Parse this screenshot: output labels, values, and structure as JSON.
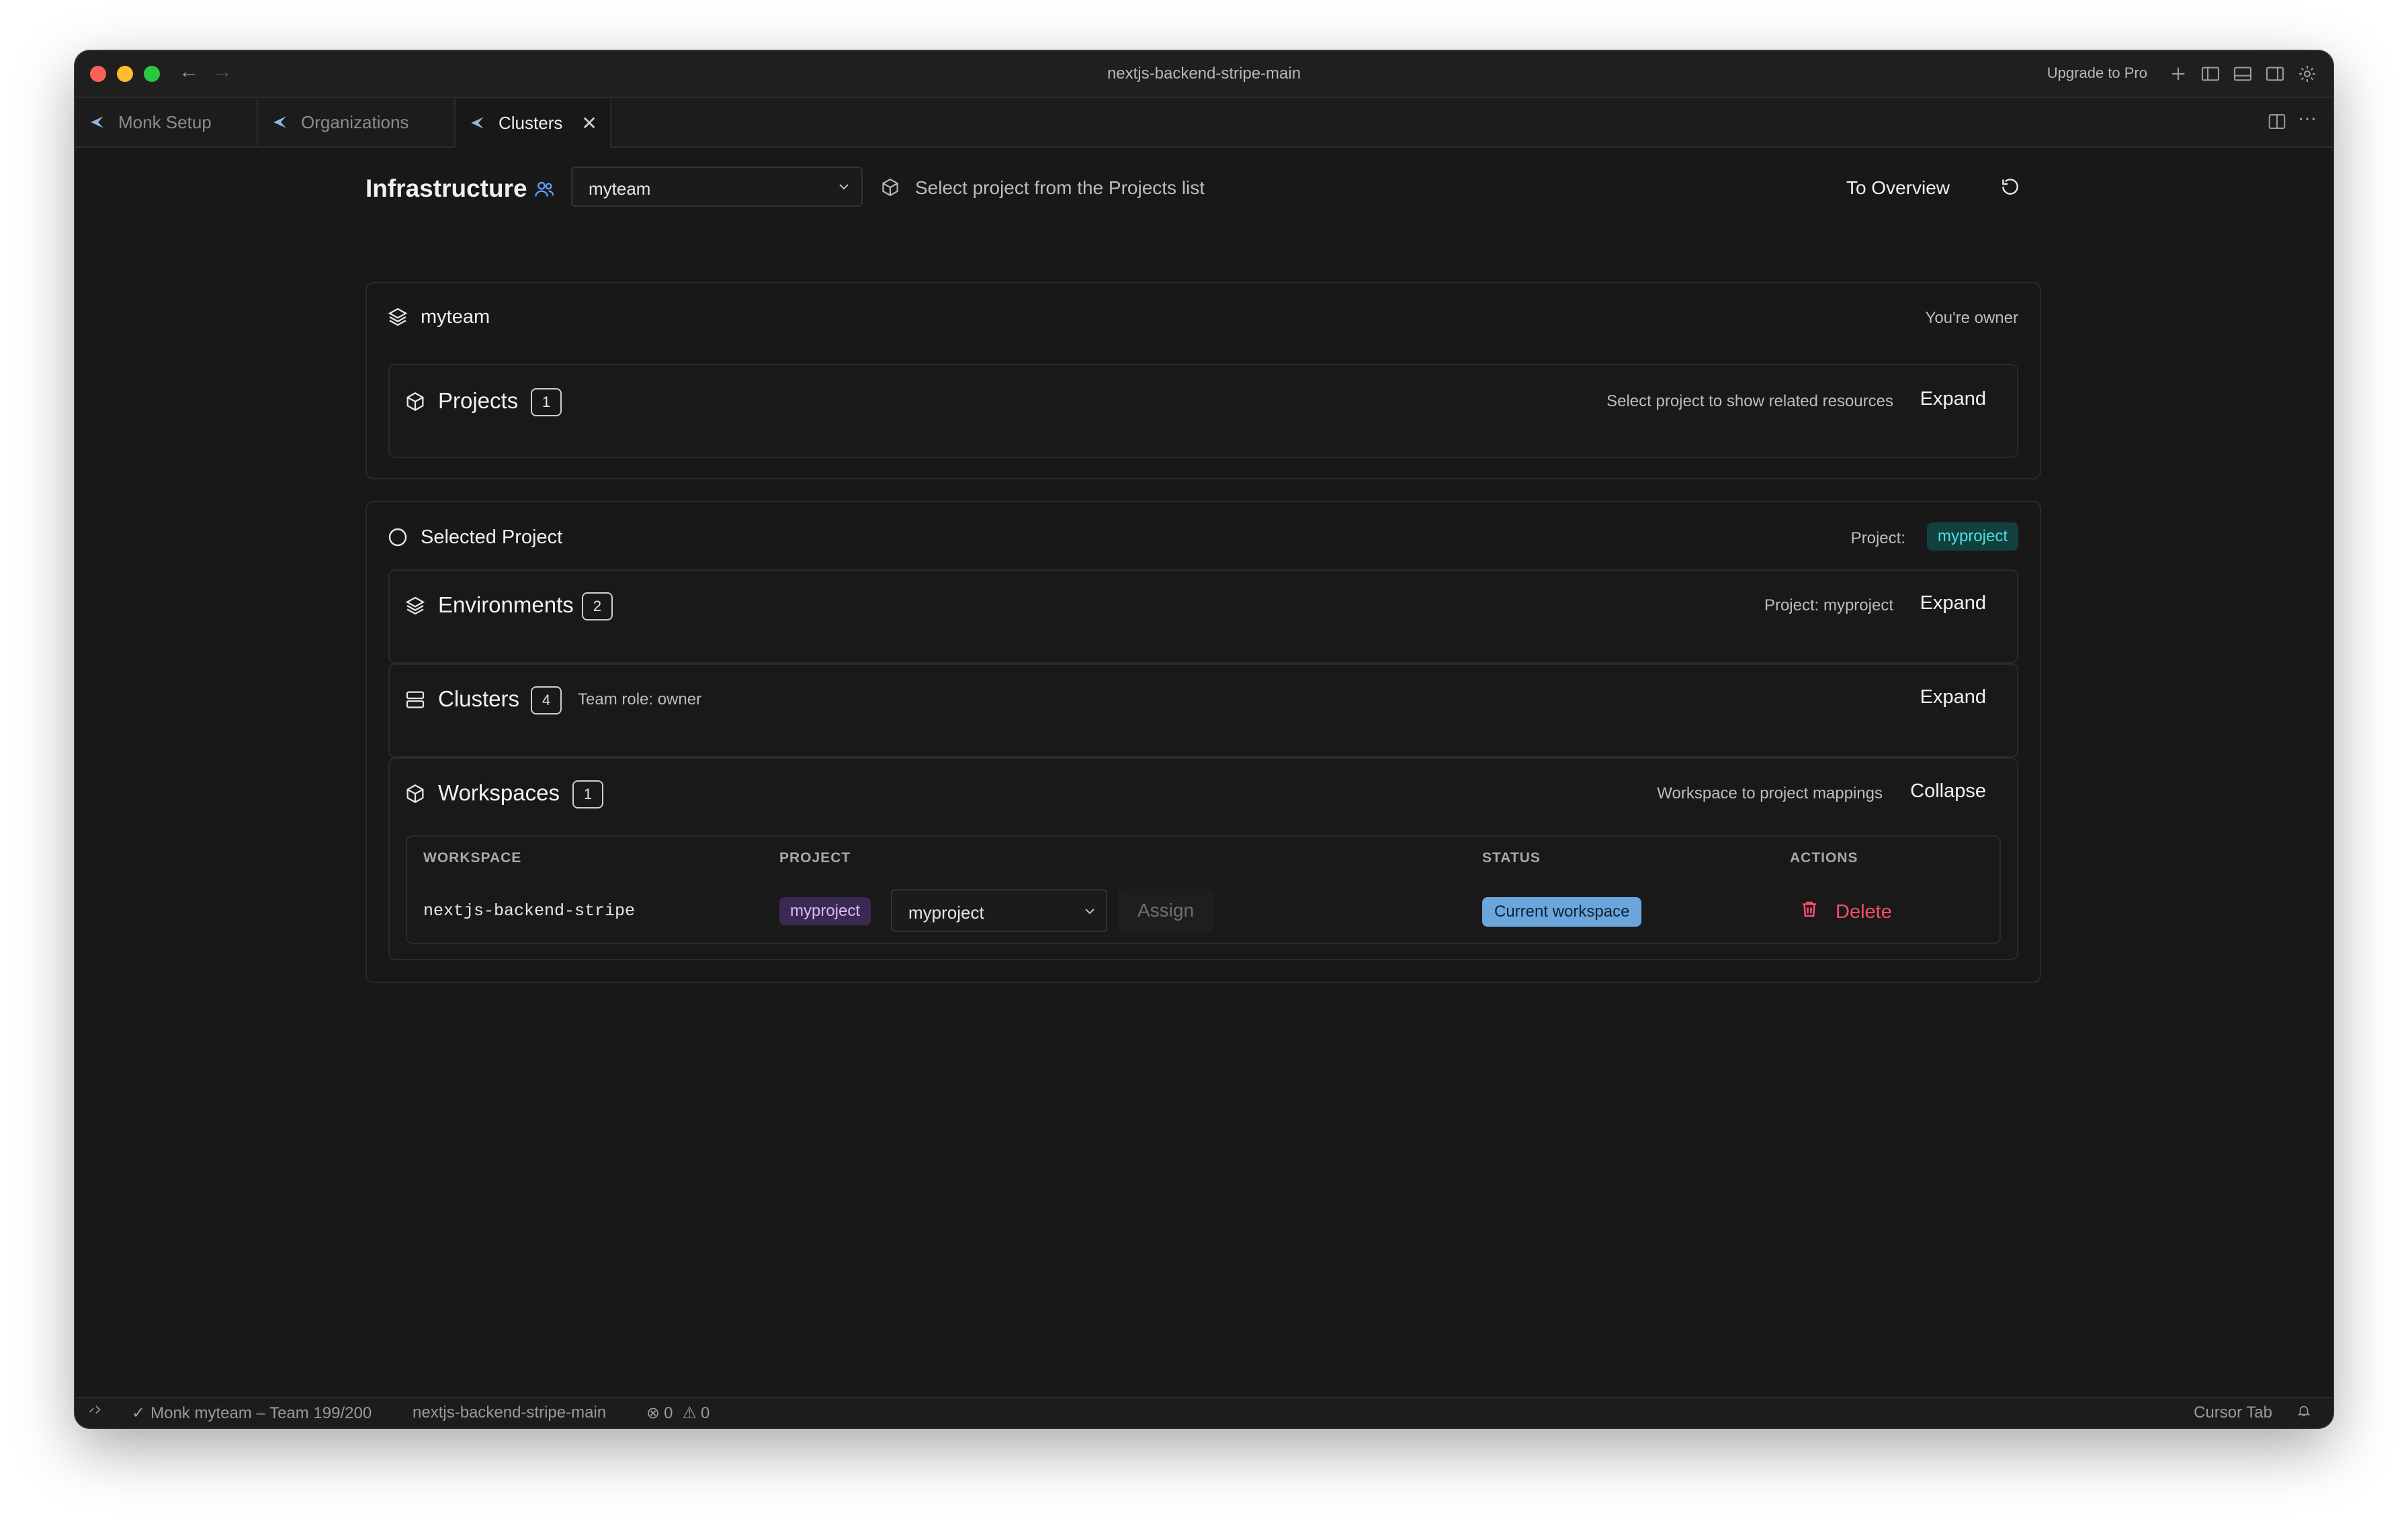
{
  "window": {
    "title": "nextjs-backend-stripe-main",
    "upgrade_label": "Upgrade to Pro"
  },
  "tabs": [
    {
      "label": "Monk Setup",
      "icon": "monk-logo-icon",
      "active": false
    },
    {
      "label": "Organizations",
      "icon": "monk-logo-icon",
      "active": false
    },
    {
      "label": "Clusters",
      "icon": "monk-logo-icon",
      "active": true
    }
  ],
  "header": {
    "title": "Infrastructure",
    "team_select_value": "myteam",
    "project_hint": "Select project from the Projects list",
    "to_overview_label": "To Overview"
  },
  "team_card": {
    "name": "myteam",
    "role_label": "You're owner",
    "projects": {
      "title": "Projects",
      "count": "1",
      "hint": "Select project to show related resources",
      "action": "Expand"
    }
  },
  "project_card": {
    "title": "Selected Project",
    "project_label": "Project:",
    "project_value": "myproject",
    "environments": {
      "title": "Environments",
      "count": "2",
      "hint": "Project: myproject",
      "action": "Expand"
    },
    "clusters": {
      "title": "Clusters",
      "count": "4",
      "hint": "Team role: owner",
      "action": "Expand"
    },
    "workspaces": {
      "title": "Workspaces",
      "count": "1",
      "hint": "Workspace to project mappings",
      "action": "Collapse",
      "columns": [
        "WORKSPACE",
        "PROJECT",
        "STATUS",
        "ACTIONS"
      ],
      "rows": [
        {
          "workspace": "nextjs-backend-stripe",
          "project_tag": "myproject",
          "project_select": "myproject",
          "assign_label": "Assign",
          "status": "Current workspace",
          "delete_label": "Delete"
        }
      ]
    }
  },
  "statusbar": {
    "account": "Monk myteam – Team 199/200",
    "branch": "nextjs-backend-stripe-main",
    "errors": "0",
    "warnings": "0",
    "cursor_tab": "Cursor Tab"
  },
  "colors": {
    "accent_blue": "#5b9bf0",
    "project_pill": "#4fe0e0",
    "status_badge": "#6aa6dc",
    "danger": "#ff4b6e"
  }
}
